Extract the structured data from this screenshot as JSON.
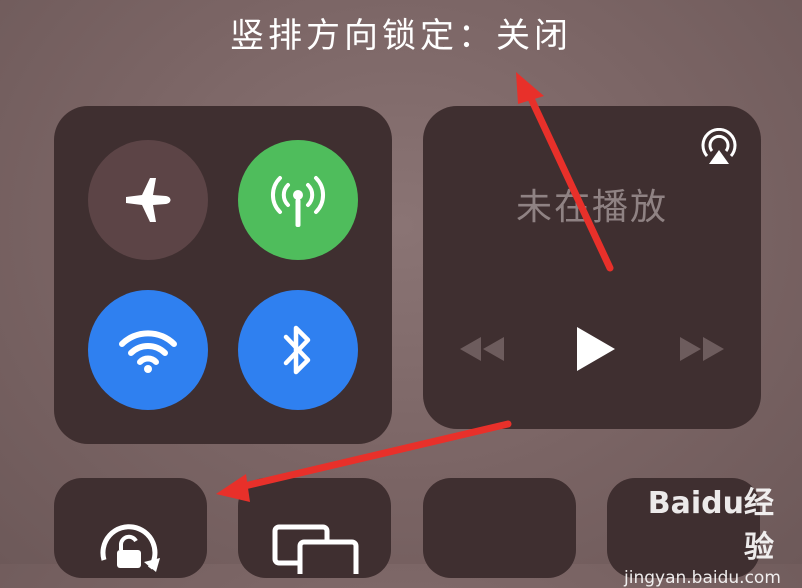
{
  "status": {
    "text": "竖排方向锁定：关闭"
  },
  "connectivity": {
    "airplane": {
      "icon": "airplane-icon",
      "state": "off",
      "color": "#5c4446"
    },
    "cellular": {
      "icon": "antenna-icon",
      "state": "on",
      "color": "#4fbd5c"
    },
    "wifi": {
      "icon": "wifi-icon",
      "state": "on",
      "color": "#2f80f0"
    },
    "bluetooth": {
      "icon": "bluetooth-icon",
      "state": "on",
      "color": "#2f80f0"
    }
  },
  "media": {
    "title": "未在播放",
    "airplay_icon": "airplay-icon",
    "controls": [
      "rewind-icon",
      "play-icon",
      "fast-forward-icon"
    ]
  },
  "bottom_tiles": [
    {
      "icon": "rotation-lock-icon"
    },
    {
      "icon": "screen-mirroring-icon"
    },
    {
      "icon": ""
    },
    {
      "icon": ""
    }
  ],
  "watermark": {
    "brand": "Baidu经验",
    "url": "jingyan.baidu.com"
  },
  "colors": {
    "background": "#7a6464",
    "panel": "#3f2f30",
    "arrow": "#e8302a"
  }
}
